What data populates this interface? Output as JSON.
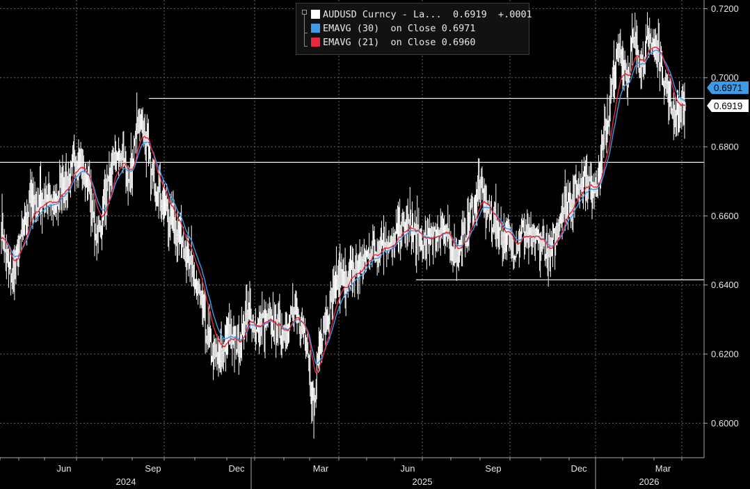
{
  "chart_data": {
    "type": "line",
    "instrument": "AUDUSD Curncy",
    "y_range": [
      0.59,
      0.7225
    ],
    "y_ticks": [
      "0.6000",
      "0.6200",
      "0.6400",
      "0.6600",
      "0.6800",
      "0.7000",
      "0.7200"
    ],
    "x_month_labels": [
      "Jun",
      "Sep",
      "Dec",
      "Mar",
      "Jun",
      "Sep",
      "Dec",
      "Mar"
    ],
    "x_year_labels": [
      "2024",
      "2025",
      "2026"
    ],
    "horizontal_lines": [
      0.694,
      0.6755,
      0.6415
    ],
    "series": [
      {
        "name": "AUDUSD Curncy - La...",
        "color": "#ffffff",
        "start": "2024-03",
        "weekly_close": [
          0.657,
          0.65,
          0.645,
          0.642,
          0.647,
          0.652,
          0.656,
          0.661,
          0.664,
          0.665,
          0.663,
          0.665,
          0.666,
          0.664,
          0.662,
          0.664,
          0.668,
          0.67,
          0.67,
          0.672,
          0.676,
          0.678,
          0.674,
          0.672,
          0.668,
          0.66,
          0.656,
          0.655,
          0.662,
          0.665,
          0.672,
          0.679,
          0.676,
          0.678,
          0.672,
          0.67,
          0.676,
          0.685,
          0.69,
          0.685,
          0.68,
          0.672,
          0.67,
          0.668,
          0.665,
          0.663,
          0.658,
          0.66,
          0.657,
          0.655,
          0.652,
          0.648,
          0.645,
          0.642,
          0.638,
          0.633,
          0.628,
          0.624,
          0.62,
          0.618,
          0.619,
          0.622,
          0.625,
          0.627,
          0.625,
          0.622,
          0.626,
          0.63,
          0.633,
          0.63,
          0.626,
          0.628,
          0.63,
          0.629,
          0.629,
          0.628,
          0.627,
          0.626,
          0.628,
          0.63,
          0.632,
          0.63,
          0.628,
          0.627,
          0.623,
          0.61,
          0.605,
          0.62,
          0.626,
          0.629,
          0.632,
          0.636,
          0.64,
          0.642,
          0.641,
          0.642,
          0.644,
          0.645,
          0.644,
          0.646,
          0.648,
          0.65,
          0.651,
          0.65,
          0.652,
          0.654,
          0.652,
          0.65,
          0.653,
          0.656,
          0.657,
          0.656,
          0.658,
          0.655,
          0.654,
          0.653,
          0.651,
          0.652,
          0.655,
          0.654,
          0.656,
          0.657,
          0.654,
          0.652,
          0.65,
          0.649,
          0.651,
          0.654,
          0.657,
          0.661,
          0.664,
          0.667,
          0.666,
          0.663,
          0.66,
          0.658,
          0.658,
          0.655,
          0.653,
          0.654,
          0.652,
          0.651,
          0.653,
          0.656,
          0.655,
          0.653,
          0.652,
          0.653,
          0.651,
          0.652,
          0.648,
          0.649,
          0.654,
          0.658,
          0.662,
          0.664,
          0.665,
          0.666,
          0.668,
          0.67,
          0.672,
          0.67,
          0.668,
          0.67,
          0.672,
          0.678,
          0.685,
          0.692,
          0.7,
          0.705,
          0.708,
          0.704,
          0.7,
          0.708,
          0.71,
          0.706,
          0.705,
          0.708,
          0.711,
          0.71,
          0.707,
          0.705,
          0.7,
          0.696,
          0.692,
          0.688,
          0.69,
          0.6919
        ]
      },
      {
        "name": "EMAVG (30)  on Close",
        "color": "#3d9be9",
        "period": 30
      },
      {
        "name": "EMAVG (21)  on Close",
        "color": "#e8283c",
        "period": 21
      }
    ]
  },
  "legend": {
    "row1": {
      "color": "#ffffff",
      "label": "AUDUSD Curncy - La...",
      "value": "0.6919",
      "change": "+.0001"
    },
    "row2": {
      "color": "#3d9be9",
      "label": "EMAVG (30)  on Close",
      "value": "0.6971"
    },
    "row3": {
      "color": "#e8283c",
      "label": "EMAVG (21)  on Close",
      "value": "0.6960"
    }
  },
  "price_tags": [
    {
      "label": "0.6971",
      "value": 0.6971,
      "bg": "#3d9be9",
      "fg": "#000000"
    },
    {
      "label": "0.6919",
      "value": 0.6919,
      "bg": "#ffffff",
      "fg": "#000000"
    }
  ]
}
